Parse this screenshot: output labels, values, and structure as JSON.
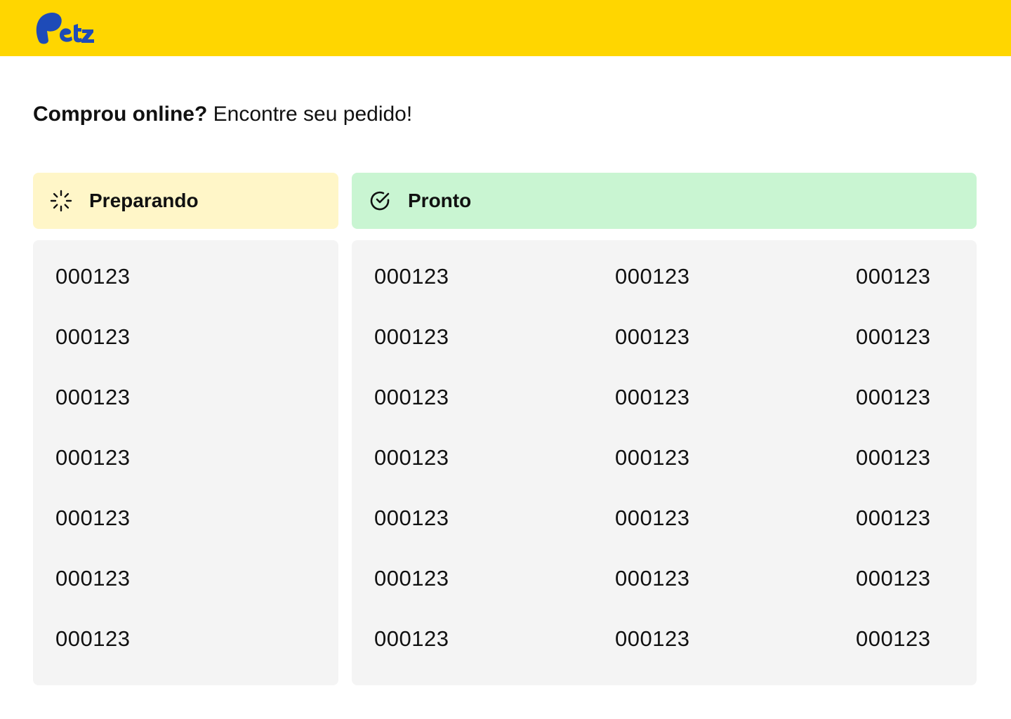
{
  "brand": {
    "name": "Petz",
    "logo_text": "Petz",
    "logo_color": "#1E4BB8",
    "bar_color": "#FFD600"
  },
  "headline": {
    "strong": "Comprou online?",
    "rest": " Encontre seu pedido!"
  },
  "preparing": {
    "label": "Preparando",
    "icon": "loader-icon",
    "color": "#FFF6C8",
    "orders": [
      "000123",
      "000123",
      "000123",
      "000123",
      "000123",
      "000123",
      "000123"
    ]
  },
  "ready": {
    "label": "Pronto",
    "icon": "check-circle-icon",
    "color": "#C9F5D2",
    "orders": [
      "000123",
      "000123",
      "000123",
      "000123",
      "000123",
      "000123",
      "000123",
      "000123",
      "000123",
      "000123",
      "000123",
      "000123",
      "000123",
      "000123",
      "000123",
      "000123",
      "000123",
      "000123",
      "000123",
      "000123",
      "000123"
    ]
  }
}
